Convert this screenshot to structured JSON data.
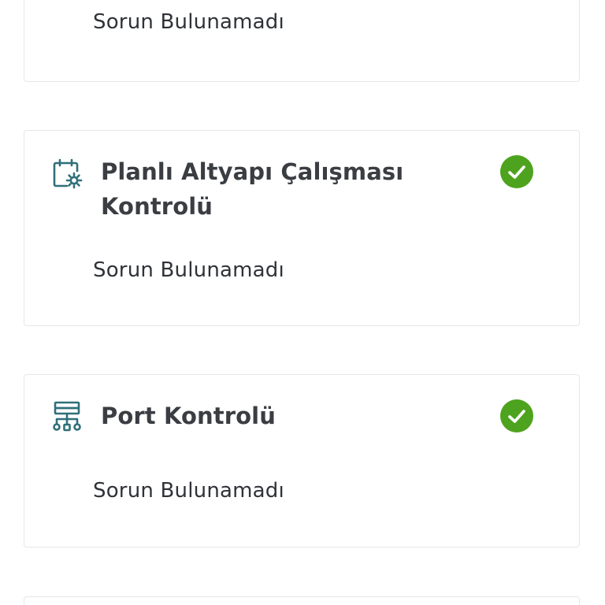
{
  "checks": [
    {
      "title": "",
      "result": "Sorun Bulunamadı"
    },
    {
      "title": "Planlı Altyapı Çalışması Kontrolü",
      "icon": "calendar-gear-icon",
      "status": "success",
      "result": "Sorun Bulunamadı"
    },
    {
      "title": "Port Kontrolü",
      "icon": "network-topology-icon",
      "status": "success",
      "result": "Sorun Bulunamadı"
    }
  ],
  "colors": {
    "icon": "#2f6f7a",
    "success": "#4ea31e",
    "title": "#3a3d42",
    "text": "#2f3338",
    "card_border": "#e4e6e8"
  }
}
